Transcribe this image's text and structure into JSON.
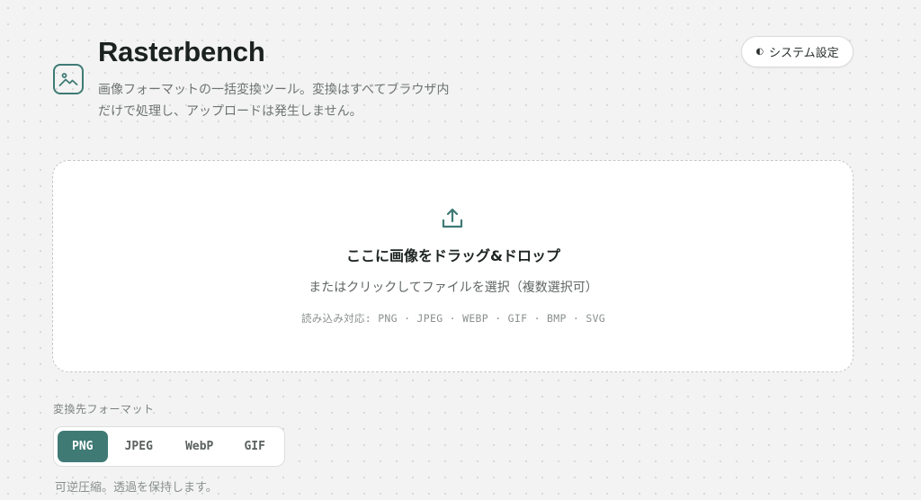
{
  "header": {
    "title": "Rasterbench",
    "description_line1": "画像フォーマットの一括変換ツール。変換はすべてブラウザ内",
    "description_line2": "だけで処理し、アップロードは発生しません。",
    "logo_icon": "image-icon"
  },
  "theme_toggle": {
    "icon": "◐",
    "label": "システム設定"
  },
  "dropzone": {
    "icon": "upload-icon",
    "title": "ここに画像をドラッグ&ドロップ",
    "subtitle": "またはクリックしてファイルを選択（複数選択可）",
    "supported_formats": "読み込み対応: PNG · JPEG · WEBP · GIF · BMP · SVG"
  },
  "output_format": {
    "label": "変換先フォーマット",
    "options": [
      "PNG",
      "JPEG",
      "WebP",
      "GIF"
    ],
    "selected": "PNG",
    "hint": "可逆圧縮。透過を保持します。"
  },
  "colors": {
    "accent": "#3f7a75",
    "background": "#f2f3f2",
    "card": "#ffffff"
  }
}
